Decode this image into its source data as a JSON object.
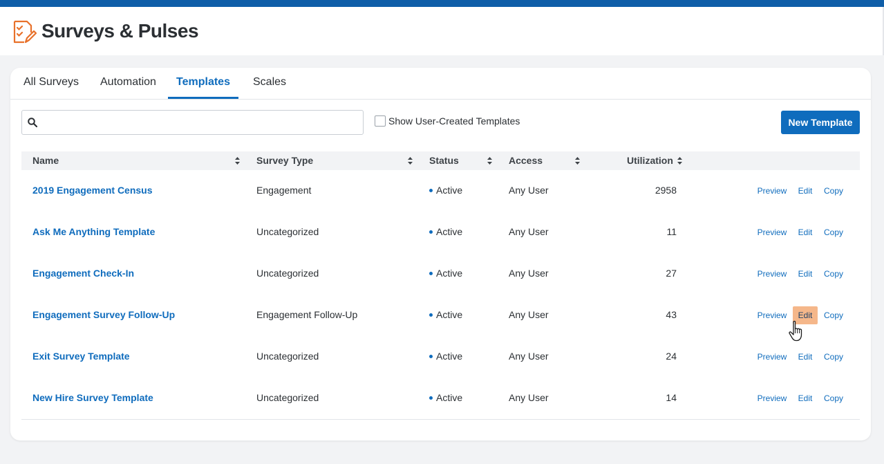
{
  "app": {
    "title": "Surveys & Pulses"
  },
  "tabs": [
    {
      "label": "All Surveys"
    },
    {
      "label": "Automation"
    },
    {
      "label": "Templates",
      "active": true
    },
    {
      "label": "Scales"
    }
  ],
  "toolbar": {
    "search_value": "",
    "search_placeholder": "",
    "show_user_created_label": "Show User-Created Templates",
    "show_user_created_checked": false,
    "new_template_label": "New Template"
  },
  "table": {
    "headers": [
      "Name",
      "Survey Type",
      "Status",
      "Access",
      "Utilization"
    ],
    "rows": [
      {
        "name": "2019 Engagement Census",
        "type": "Engagement",
        "status": "Active",
        "access": "Any User",
        "utilization": "2958"
      },
      {
        "name": "Ask Me Anything Template",
        "type": "Uncategorized",
        "status": "Active",
        "access": "Any User",
        "utilization": "11"
      },
      {
        "name": "Engagement Check-In",
        "type": "Uncategorized",
        "status": "Active",
        "access": "Any User",
        "utilization": "27"
      },
      {
        "name": "Engagement Survey Follow-Up",
        "type": "Engagement Follow-Up",
        "status": "Active",
        "access": "Any User",
        "utilization": "43"
      },
      {
        "name": "Exit Survey Template",
        "type": "Uncategorized",
        "status": "Active",
        "access": "Any User",
        "utilization": "24"
      },
      {
        "name": "New Hire Survey Template",
        "type": "Uncategorized",
        "status": "Active",
        "access": "Any User",
        "utilization": "14"
      }
    ],
    "actions": {
      "preview": "Preview",
      "edit": "Edit",
      "copy": "Copy"
    }
  },
  "colors": {
    "brand": "#0f5ea8",
    "link": "#0f6cbd",
    "hover_highlight": "#f5b78a",
    "app_icon": "#e8712a"
  }
}
